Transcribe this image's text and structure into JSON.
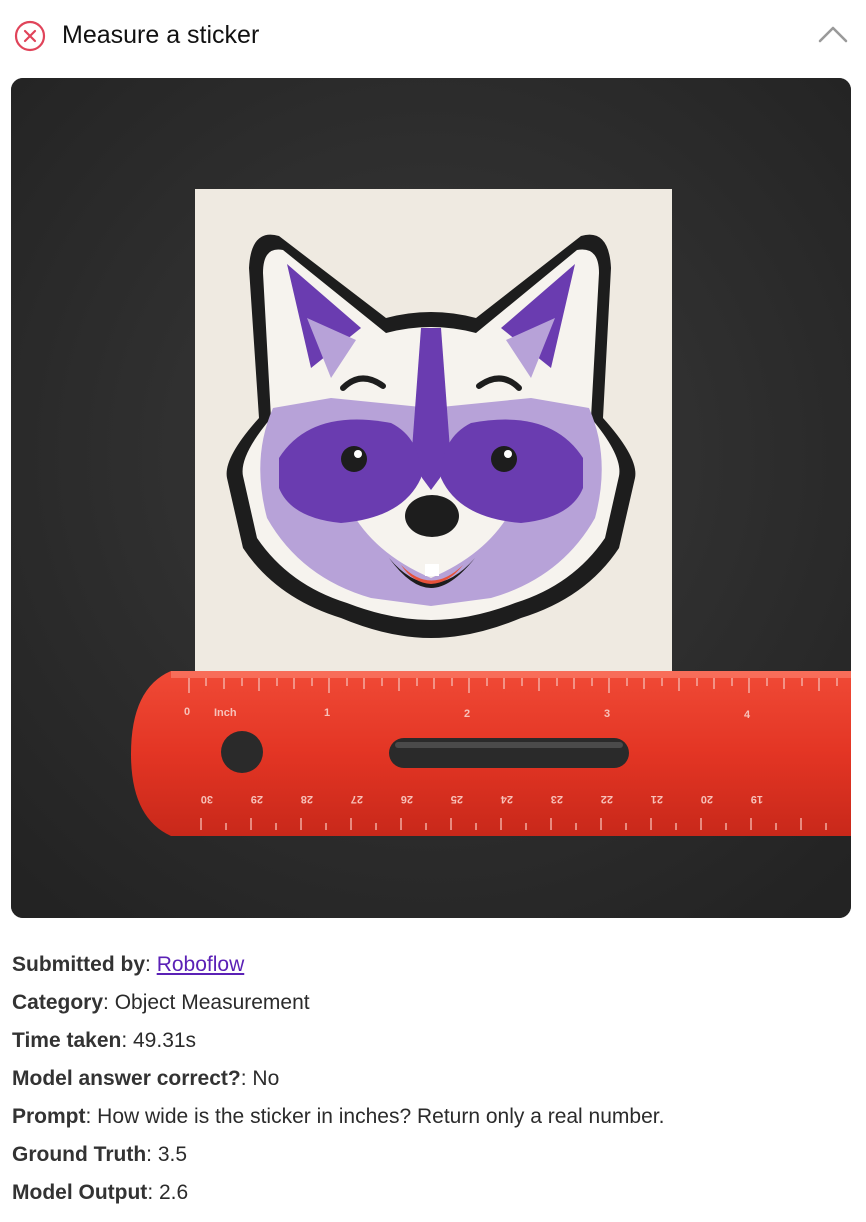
{
  "header": {
    "status_icon": "x-circle-icon",
    "status_color": "#e0445a",
    "title": "Measure a sticker",
    "collapse_icon": "chevron-up-icon"
  },
  "image": {
    "ruler": {
      "inch_label": "Inch",
      "inch_ticks": [
        "0",
        "1",
        "2",
        "3",
        "4"
      ],
      "cm_ticks": [
        "30",
        "29",
        "28",
        "27",
        "26",
        "25",
        "24",
        "23",
        "22",
        "21",
        "20",
        "19"
      ]
    },
    "colors": {
      "background": "#2e2e2e",
      "sticker": "#efeae1",
      "fox_purple": "#6a3cb0",
      "fox_lilac": "#b7a2d8",
      "ruler_red": "#e33524"
    }
  },
  "details": {
    "submitted_by_label": "Submitted by",
    "submitted_by_value": "Roboflow",
    "category_label": "Category",
    "category_value": "Object Measurement",
    "time_label": "Time taken",
    "time_value": "49.31s",
    "correct_label": "Model answer correct?",
    "correct_value": "No",
    "prompt_label": "Prompt",
    "prompt_value": "How wide is the sticker in inches? Return only a real number.",
    "ground_truth_label": "Ground Truth",
    "ground_truth_value": "3.5",
    "output_label": "Model Output",
    "output_value": "2.6"
  }
}
